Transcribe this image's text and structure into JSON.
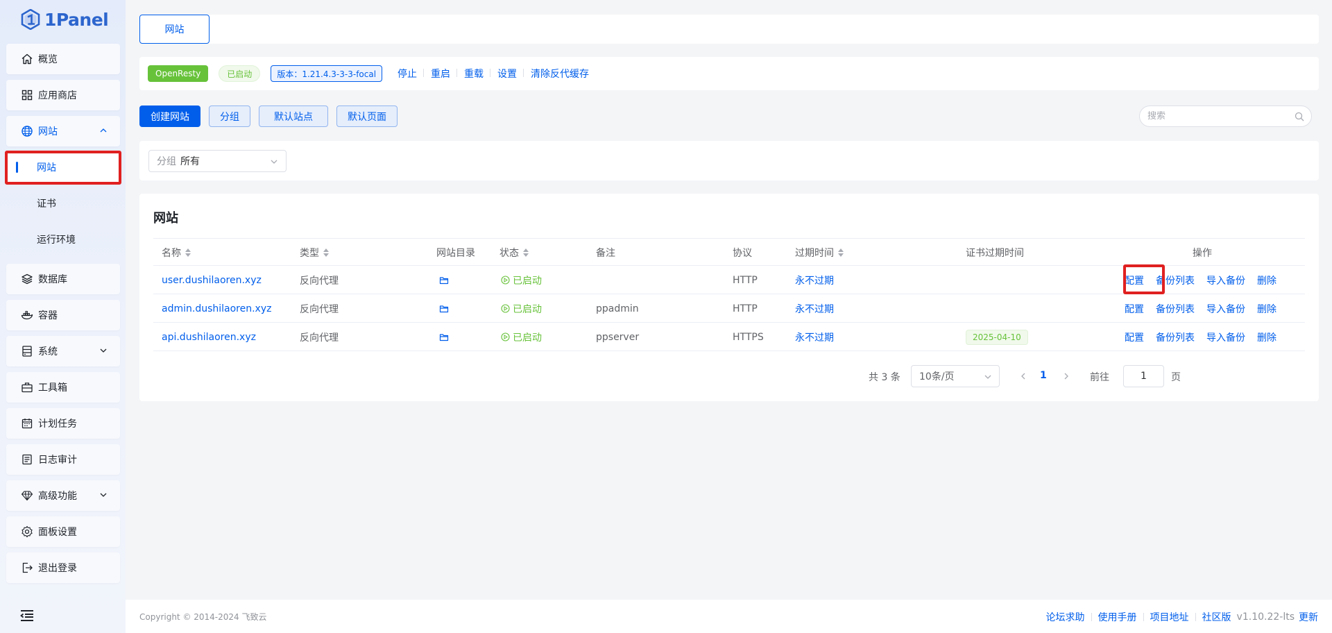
{
  "brand": {
    "name": "1Panel"
  },
  "sidebar": {
    "items": [
      {
        "label": "概览",
        "icon": "home-icon"
      },
      {
        "label": "应用商店",
        "icon": "grid-icon"
      },
      {
        "label": "网站",
        "icon": "globe-icon",
        "expanded": true
      },
      {
        "label": "数据库",
        "icon": "layers-icon"
      },
      {
        "label": "容器",
        "icon": "docker-icon"
      },
      {
        "label": "系统",
        "icon": "server-icon"
      },
      {
        "label": "工具箱",
        "icon": "toolbox-icon"
      },
      {
        "label": "计划任务",
        "icon": "calendar-icon"
      },
      {
        "label": "日志审计",
        "icon": "log-icon"
      },
      {
        "label": "高级功能",
        "icon": "diamond-icon"
      },
      {
        "label": "面板设置",
        "icon": "gear-icon"
      },
      {
        "label": "退出登录",
        "icon": "logout-icon"
      }
    ],
    "sub_items": [
      {
        "label": "网站",
        "active": true
      },
      {
        "label": "证书"
      },
      {
        "label": "运行环境"
      }
    ]
  },
  "tabs": [
    {
      "label": "网站"
    }
  ],
  "app_bar": {
    "app_name": "OpenResty",
    "status": "已启动",
    "version": "版本：1.21.4.3-3-3-focal",
    "actions": [
      "停止",
      "重启",
      "重载",
      "设置",
      "清除反代缓存"
    ]
  },
  "toolbar": {
    "create": "创建网站",
    "group": "分组",
    "default_site": "默认站点",
    "default_page": "默认页面",
    "search_placeholder": "搜索"
  },
  "filter": {
    "label": "分组",
    "value": "所有"
  },
  "table": {
    "title": "网站",
    "columns": [
      "名称",
      "类型",
      "网站目录",
      "状态",
      "备注",
      "协议",
      "过期时间",
      "证书过期时间",
      "操作"
    ],
    "rows": [
      {
        "name": "user.dushilaoren.xyz",
        "type": "反向代理",
        "status": "已启动",
        "remark": "",
        "protocol": "HTTP",
        "expire": "永不过期",
        "cert_expire": ""
      },
      {
        "name": "admin.dushilaoren.xyz",
        "type": "反向代理",
        "status": "已启动",
        "remark": "ppadmin",
        "protocol": "HTTP",
        "expire": "永不过期",
        "cert_expire": ""
      },
      {
        "name": "api.dushilaoren.xyz",
        "type": "反向代理",
        "status": "已启动",
        "remark": "ppserver",
        "protocol": "HTTPS",
        "expire": "永不过期",
        "cert_expire": "2025-04-10"
      }
    ],
    "row_actions": [
      "配置",
      "备份列表",
      "导入备份",
      "删除"
    ]
  },
  "pagination": {
    "total": "共 3 条",
    "page_size": "10条/页",
    "current_page": "1",
    "goto_label": "前往",
    "goto_value": "1",
    "page_unit": "页"
  },
  "footer": {
    "copyright": "Copyright © 2014-2024 飞致云",
    "links": [
      "论坛求助",
      "使用手册",
      "项目地址",
      "社区版"
    ],
    "version": "v1.10.22-lts",
    "update": "更新"
  },
  "colors": {
    "primary": "#005eeb",
    "success": "#67c23a",
    "highlight": "#e02020"
  }
}
